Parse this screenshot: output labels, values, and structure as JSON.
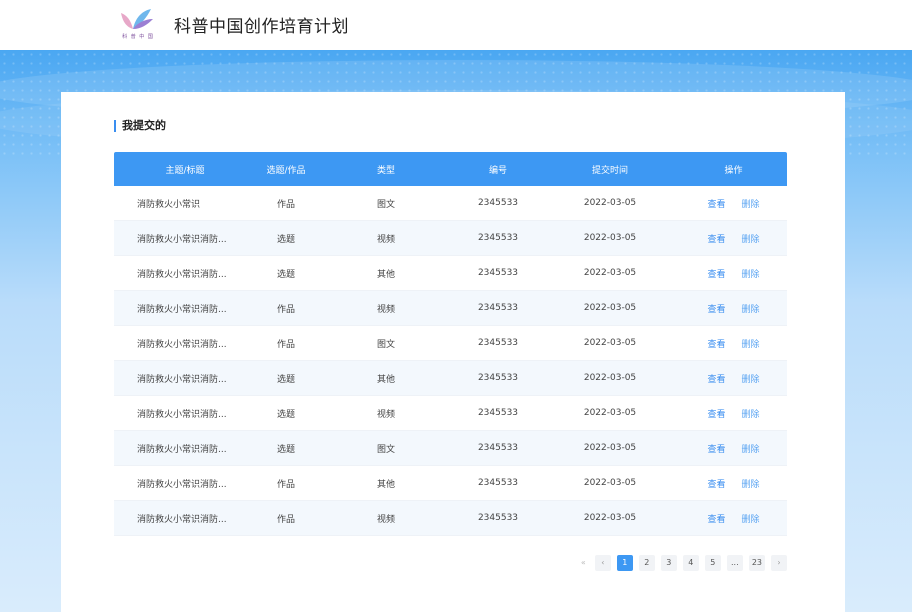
{
  "header": {
    "logo_caption": "科 普 中 国",
    "site_title": "科普中国创作培育计划"
  },
  "main": {
    "section_title": "我提交的",
    "columns": [
      "主题/标题",
      "选题/作品",
      "类型",
      "编号",
      "提交时间",
      "操作"
    ],
    "rows": [
      {
        "title": "消防救火小常识",
        "kind": "作品",
        "type": "图文",
        "code": "2345533",
        "date": "2022-03-05",
        "view": "查看",
        "delete": "删除"
      },
      {
        "title": "消防救火小常识消防...",
        "kind": "选题",
        "type": "视频",
        "code": "2345533",
        "date": "2022-03-05",
        "view": "查看",
        "delete": "删除"
      },
      {
        "title": "消防救火小常识消防...",
        "kind": "选题",
        "type": "其他",
        "code": "2345533",
        "date": "2022-03-05",
        "view": "查看",
        "delete": "删除"
      },
      {
        "title": "消防救火小常识消防...",
        "kind": "作品",
        "type": "视频",
        "code": "2345533",
        "date": "2022-03-05",
        "view": "查看",
        "delete": "删除"
      },
      {
        "title": "消防救火小常识消防...",
        "kind": "作品",
        "type": "图文",
        "code": "2345533",
        "date": "2022-03-05",
        "view": "查看",
        "delete": "删除"
      },
      {
        "title": "消防救火小常识消防...",
        "kind": "选题",
        "type": "其他",
        "code": "2345533",
        "date": "2022-03-05",
        "view": "查看",
        "delete": "删除"
      },
      {
        "title": "消防救火小常识消防...",
        "kind": "选题",
        "type": "视频",
        "code": "2345533",
        "date": "2022-03-05",
        "view": "查看",
        "delete": "删除"
      },
      {
        "title": "消防救火小常识消防...",
        "kind": "选题",
        "type": "图文",
        "code": "2345533",
        "date": "2022-03-05",
        "view": "查看",
        "delete": "删除"
      },
      {
        "title": "消防救火小常识消防...",
        "kind": "作品",
        "type": "其他",
        "code": "2345533",
        "date": "2022-03-05",
        "view": "查看",
        "delete": "删除"
      },
      {
        "title": "消防救火小常识消防...",
        "kind": "作品",
        "type": "视频",
        "code": "2345533",
        "date": "2022-03-05",
        "view": "查看",
        "delete": "删除"
      }
    ]
  },
  "pagination": {
    "first": "«",
    "prev": "‹",
    "pages": [
      "1",
      "2",
      "3",
      "4",
      "5",
      "...",
      "23"
    ],
    "current": "1",
    "next": "›"
  },
  "colors": {
    "accent": "#3d98f3",
    "header_bg": "#ffffff",
    "row_alt": "#f3f8fd"
  }
}
